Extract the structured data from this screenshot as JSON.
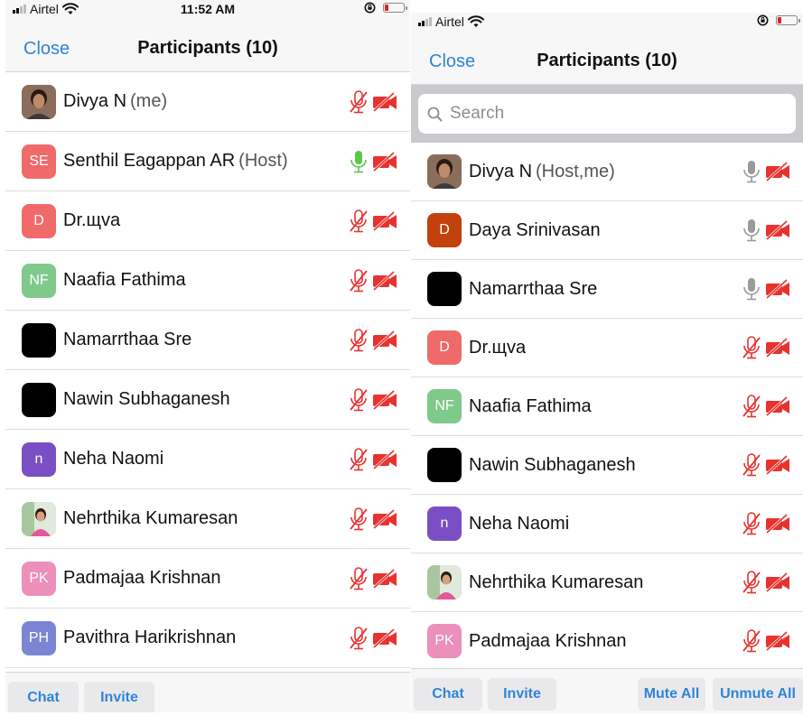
{
  "left_screen": {
    "status": {
      "carrier": "Airtel",
      "time": "11:52 AM"
    },
    "nav": {
      "close": "Close",
      "title": "Participants (10)"
    },
    "participants": [
      {
        "name": "Divya N",
        "role": "(me)",
        "initials": "",
        "avatar_color": "#6b4c3a",
        "avatar_type": "photo",
        "mic": "muted"
      },
      {
        "name": "Senthil Eagappan AR",
        "role": "(Host)",
        "initials": "SE",
        "avatar_color": "#f06a6a",
        "avatar_type": "initials",
        "mic": "active"
      },
      {
        "name": "Dr.щva",
        "role": "",
        "initials": "D",
        "avatar_color": "#f06a6a",
        "avatar_type": "initials",
        "mic": "muted"
      },
      {
        "name": "Naafia Fathima",
        "role": "",
        "initials": "NF",
        "avatar_color": "#7fc98a",
        "avatar_type": "initials",
        "mic": "muted"
      },
      {
        "name": "Namarrthaa Sre",
        "role": "",
        "initials": "",
        "avatar_color": "#000000",
        "avatar_type": "initials",
        "mic": "muted"
      },
      {
        "name": "Nawin Subhaganesh",
        "role": "",
        "initials": "",
        "avatar_color": "#000000",
        "avatar_type": "initials",
        "mic": "muted"
      },
      {
        "name": "Neha Naomi",
        "role": "",
        "initials": "n",
        "avatar_color": "#7b4fc4",
        "avatar_type": "initials",
        "mic": "muted"
      },
      {
        "name": "Nehrthika Kumaresan",
        "role": "",
        "initials": "",
        "avatar_color": "#e7a3c1",
        "avatar_type": "photo2",
        "mic": "muted"
      },
      {
        "name": "Padmajaa Krishnan",
        "role": "",
        "initials": "PK",
        "avatar_color": "#ec8fba",
        "avatar_type": "initials",
        "mic": "muted"
      },
      {
        "name": "Pavithra Harikrishnan",
        "role": "",
        "initials": "PH",
        "avatar_color": "#7a86d3",
        "avatar_type": "initials",
        "mic": "muted"
      }
    ],
    "buttons": {
      "chat": "Chat",
      "invite": "Invite"
    }
  },
  "right_screen": {
    "status": {
      "carrier": "Airtel"
    },
    "nav": {
      "close": "Close",
      "title": "Participants (10)"
    },
    "search": {
      "placeholder": "Search"
    },
    "participants": [
      {
        "name": "Divya N",
        "role": "(Host,me)",
        "initials": "",
        "avatar_color": "#6b4c3a",
        "avatar_type": "photo",
        "mic": "unmuted"
      },
      {
        "name": "Daya Srinivasan",
        "role": "",
        "initials": "D",
        "avatar_color": "#c2410c",
        "avatar_type": "initials",
        "mic": "unmuted"
      },
      {
        "name": "Namarrthaa Sre",
        "role": "",
        "initials": "",
        "avatar_color": "#000000",
        "avatar_type": "initials",
        "mic": "unmuted"
      },
      {
        "name": "Dr.щva",
        "role": "",
        "initials": "D",
        "avatar_color": "#f06a6a",
        "avatar_type": "initials",
        "mic": "muted"
      },
      {
        "name": "Naafia Fathima",
        "role": "",
        "initials": "NF",
        "avatar_color": "#7fc98a",
        "avatar_type": "initials",
        "mic": "muted"
      },
      {
        "name": "Nawin Subhaganesh",
        "role": "",
        "initials": "",
        "avatar_color": "#000000",
        "avatar_type": "initials",
        "mic": "muted"
      },
      {
        "name": "Neha Naomi",
        "role": "",
        "initials": "n",
        "avatar_color": "#7b4fc4",
        "avatar_type": "initials",
        "mic": "muted"
      },
      {
        "name": "Nehrthika Kumaresan",
        "role": "",
        "initials": "",
        "avatar_color": "#e7a3c1",
        "avatar_type": "photo2",
        "mic": "muted"
      },
      {
        "name": "Padmajaa Krishnan",
        "role": "",
        "initials": "PK",
        "avatar_color": "#ec8fba",
        "avatar_type": "initials",
        "mic": "muted"
      }
    ],
    "buttons": {
      "chat": "Chat",
      "invite": "Invite",
      "mute_all": "Mute All",
      "unmute_all": "Unmute All"
    }
  },
  "colors": {
    "accent": "#2f84d8",
    "muted_red": "#e8322f",
    "active_green": "#5cc64a",
    "unmuted_gray": "#9a9a9a"
  },
  "icons": {
    "mic": "microphone-icon",
    "camera_off": "video-off-icon",
    "search": "search-icon"
  }
}
